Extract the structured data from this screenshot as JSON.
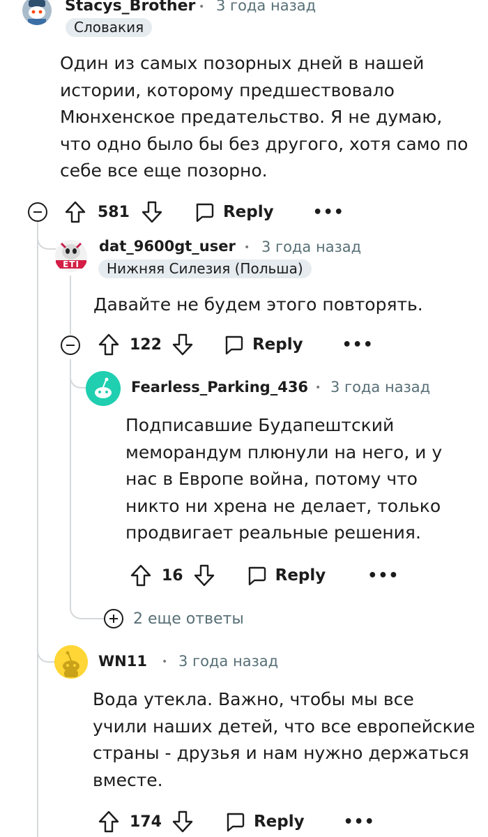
{
  "colors": {
    "text": "#1c1c1c",
    "meta": "#576f76",
    "flair_bg": "#e5ebee",
    "thread_line": "#d5d8da",
    "avatar_teal": "#1fcfb0",
    "avatar_yellow": "#ffd635"
  },
  "comments": [
    {
      "username": "Stacys_Brother",
      "separator": "•",
      "time": "3 года назад",
      "flair": "Словакия",
      "avatar_icon": "snoo-avatar-icon",
      "body": [
        "Один из самых позорных дней в нашей",
        "истории, которому предшествовало",
        "Мюнхенское предательство. Я не думаю,",
        "что одно было бы без другого, хотя само по",
        "себе все еще позорно."
      ],
      "votes": "581",
      "reply_label": "Reply",
      "more_label": "•••"
    },
    {
      "username": "dat_9600gt_user",
      "separator": "•",
      "time": "3 года назад",
      "flair": "Нижняя Силезия (Польша)",
      "avatar_icon": "yeti-avatar-icon",
      "avatar_text": "ETI",
      "body": [
        "Давайте не будем этого повторять."
      ],
      "votes": "122",
      "reply_label": "Reply",
      "more_label": "•••"
    },
    {
      "username": "Fearless_Parking_436",
      "separator": "•",
      "time": "3 года назад",
      "avatar_icon": "default-snoo-avatar-icon",
      "body": [
        "Подписавшие Будапештский",
        "меморандум плюнули на него, и у",
        "нас в Европе война, потому что",
        "никто ни хрена не делает, только",
        "продвигает реальные решения."
      ],
      "votes": "16",
      "reply_label": "Reply",
      "more_label": "•••"
    },
    {
      "username": "WN11",
      "separator": "•",
      "time": "3 года назад",
      "avatar_icon": "default-snoo-avatar-icon",
      "body": [
        "Вода утекла. Важно, чтобы мы все",
        "учили наших детей, что все европейские",
        "страны - друзья и нам нужно держаться",
        "вместе."
      ],
      "votes": "174",
      "reply_label": "Reply",
      "more_label": "•••"
    }
  ],
  "more_replies": "2 еще ответы"
}
